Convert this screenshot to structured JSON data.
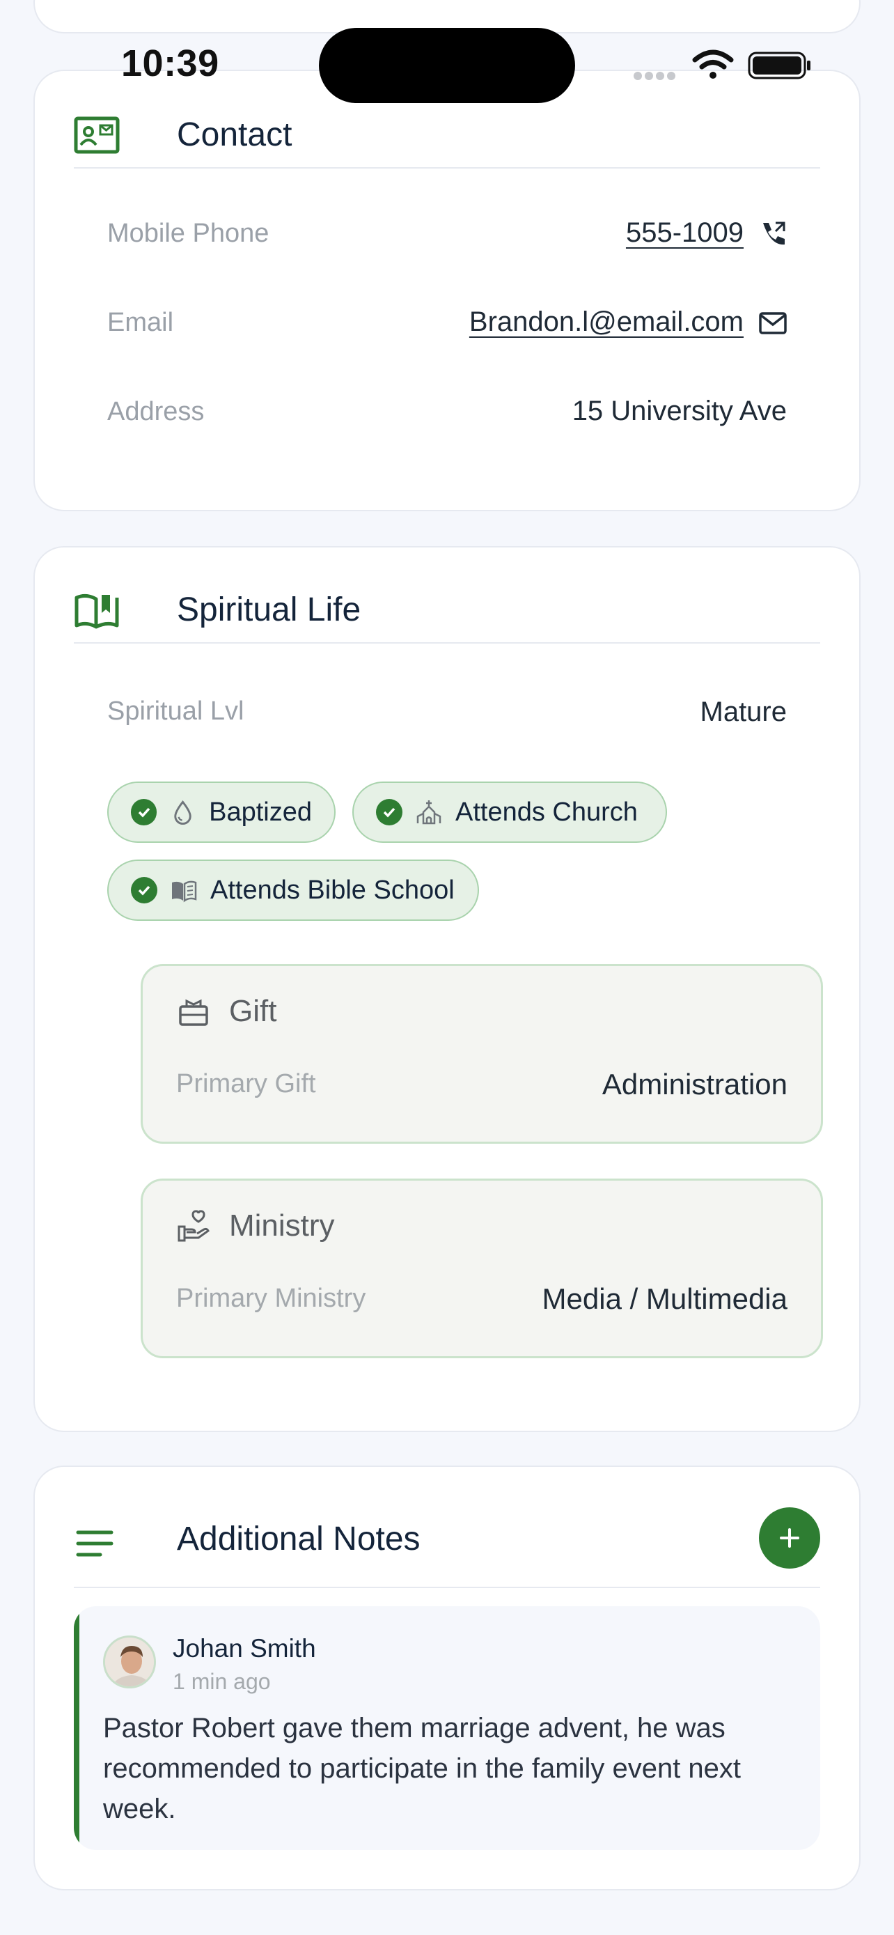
{
  "status_bar": {
    "time": "10:39"
  },
  "contact": {
    "title": "Contact",
    "rows": [
      {
        "label": "Mobile Phone",
        "value": "555-1009",
        "icon": "phone-call-icon"
      },
      {
        "label": "Email",
        "value": "Brandon.l@email.com",
        "icon": "mail-icon"
      },
      {
        "label": "Address",
        "value": "15 University Ave"
      }
    ]
  },
  "spiritual": {
    "title": "Spiritual Life",
    "level_label": "Spiritual Lvl",
    "level_value": "Mature",
    "chips": [
      {
        "label": "Baptized",
        "icon": "water-drop-icon"
      },
      {
        "label": "Attends Church",
        "icon": "church-icon"
      },
      {
        "label": "Attends Bible School",
        "icon": "book-icon"
      }
    ],
    "gift": {
      "title": "Gift",
      "label": "Primary Gift",
      "value": "Administration"
    },
    "ministry": {
      "title": "Ministry",
      "label": "Primary Ministry",
      "value": "Media / Multimedia"
    }
  },
  "notes": {
    "title": "Additional Notes",
    "items": [
      {
        "author": "Johan Smith",
        "time": "1 min ago",
        "text": "Pastor Robert gave them marriage advent, he was recommended to participate in the family event next week."
      }
    ]
  },
  "colors": {
    "accent": "#2e7d32",
    "chip_bg": "#e6f1e6",
    "page_bg": "#f5f7fc"
  }
}
